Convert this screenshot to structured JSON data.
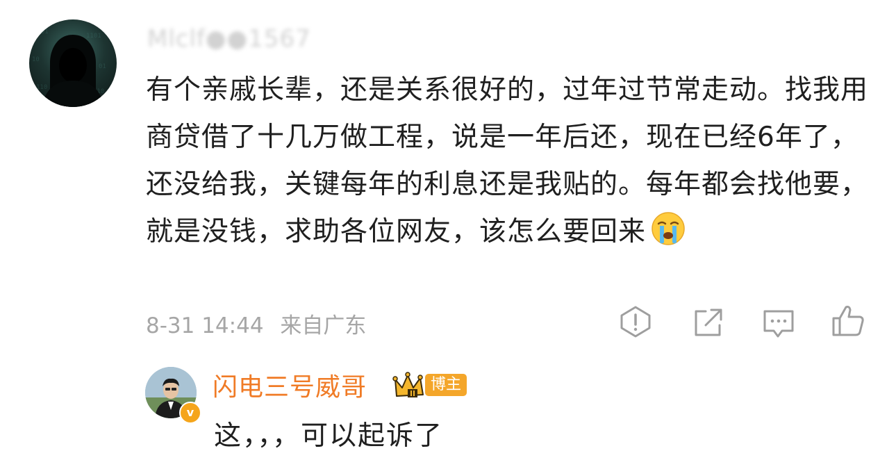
{
  "comment": {
    "username": "Mlclf●●1567",
    "text": "有个亲戚长辈，还是关系很好的，过年过节常走动。找我用商贷借了十几万做工程，说是一年后还，现在已经6年了，还没给我，关键每年的利息还是我贴的。每年都会找他要，就是没钱，求助各位网友，该怎么要回来",
    "emoji": "crying-face",
    "time": "8-31 14:44",
    "location": "来自广东",
    "actions": [
      "report-icon",
      "share-icon",
      "reply-icon",
      "like-icon"
    ]
  },
  "reply": {
    "name": "闪电三号威哥",
    "badge": "博主",
    "verified_mark": "v",
    "text": "这，，，可以起诉了"
  },
  "colors": {
    "text": "#1f1f1f",
    "meta": "#a6a6a6",
    "author_name": "#f07b26",
    "badge": "#f4a62a"
  }
}
